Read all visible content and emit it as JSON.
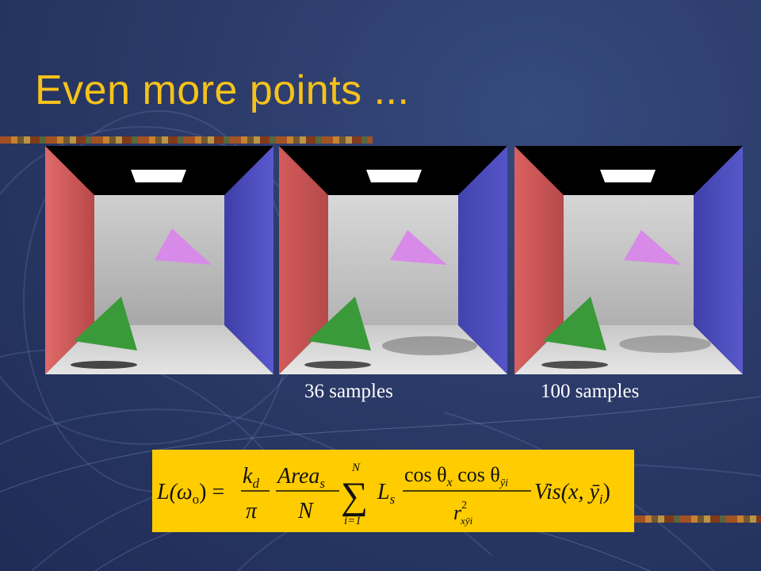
{
  "slide": {
    "title": "Even more points ..."
  },
  "renders": [
    {
      "caption": ""
    },
    {
      "caption": "36 samples"
    },
    {
      "caption": "100 samples"
    }
  ],
  "colors": {
    "title": "#f6c21a",
    "background": "#2b3a68",
    "formula_box": "#ffcc00",
    "wall_red": "#d45a5a",
    "wall_blue": "#4f4fc0",
    "triangle_green": "#3a9a3a",
    "triangle_pink": "#d78ae8"
  },
  "formula": {
    "lhs": "L(ω",
    "lhs_sub": "o",
    "lhs_close": ") =",
    "kd_num": "k",
    "kd_num_sub": "d",
    "kd_den": "π",
    "area_num": "Area",
    "area_num_sub": "s",
    "area_den": "N",
    "sum_upper": "N",
    "sum_symbol": "∑",
    "sum_lower": "i=1",
    "ls": "L",
    "ls_sub": "s",
    "cos_num": "cos θ",
    "cos_num_sub1": "x",
    "cos_num_mid": " cos θ",
    "cos_num_sub2": "ȳi",
    "cos_den": "r",
    "cos_den_sup": "2",
    "cos_den_sub": "xȳi",
    "vis": "Vis(x, ȳ",
    "vis_sub": "i",
    "vis_close": ")"
  }
}
